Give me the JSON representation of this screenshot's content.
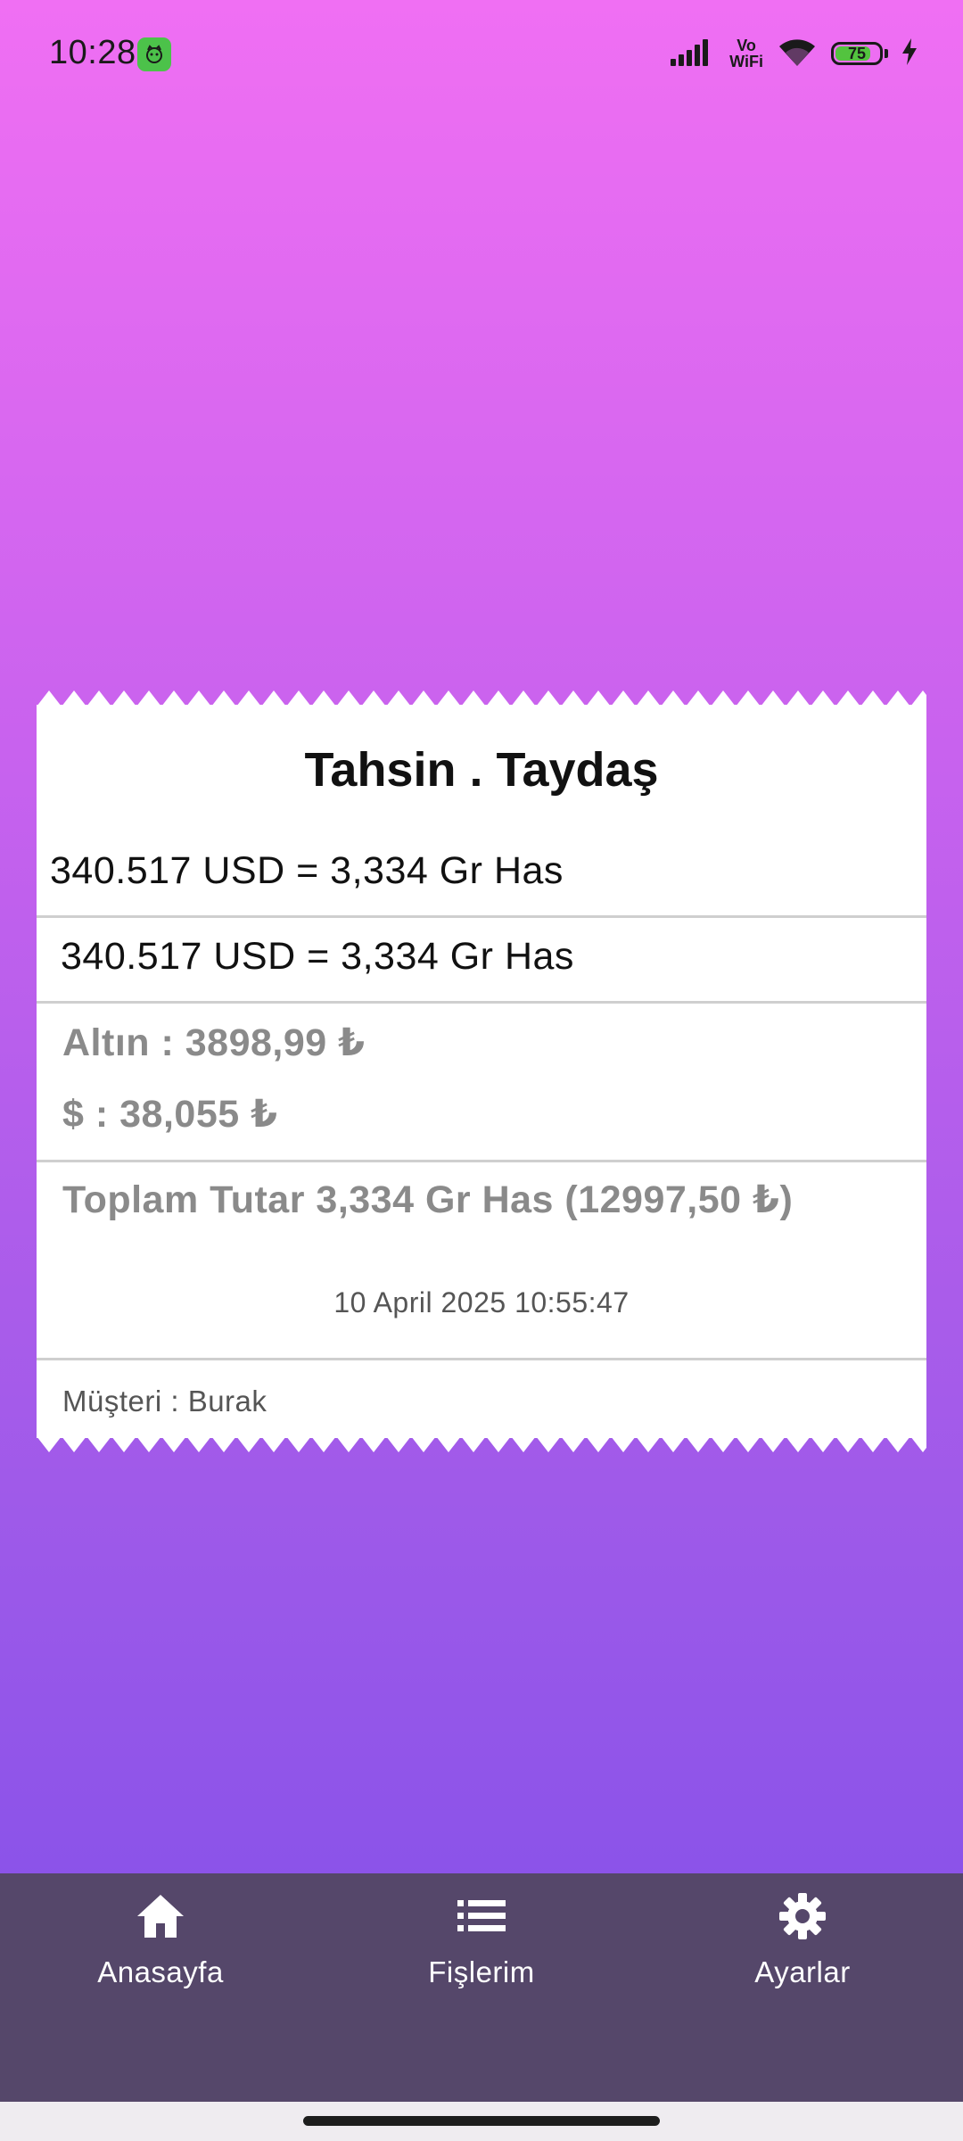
{
  "status_bar": {
    "time": "10:28",
    "network_label_top": "Vo",
    "network_label_bottom": "WiFi",
    "battery_level": "75"
  },
  "receipt": {
    "title": "Tahsin . Taydaş",
    "line1": "340.517 USD = 3,334 Gr Has",
    "line2": "340.517 USD = 3,334 Gr Has",
    "gold_rate": "Altın : 3898,99 ₺",
    "usd_rate": "$ : 38,055 ₺",
    "total": "Toplam Tutar 3,334 Gr Has (12997,50 ₺)",
    "date": "10 April 2025 10:55:47",
    "customer": "Müşteri : Burak"
  },
  "nav": {
    "items": [
      {
        "label": "Anasayfa",
        "icon": "home-icon"
      },
      {
        "label": "Fişlerim",
        "icon": "list-icon"
      },
      {
        "label": "Ayarlar",
        "icon": "gear-icon"
      }
    ]
  },
  "colors": {
    "gradient_top": "#f06ff3",
    "gradient_bottom": "#7d4ee9",
    "nav_background": "#55476a",
    "receipt_background": "#ffffff"
  }
}
